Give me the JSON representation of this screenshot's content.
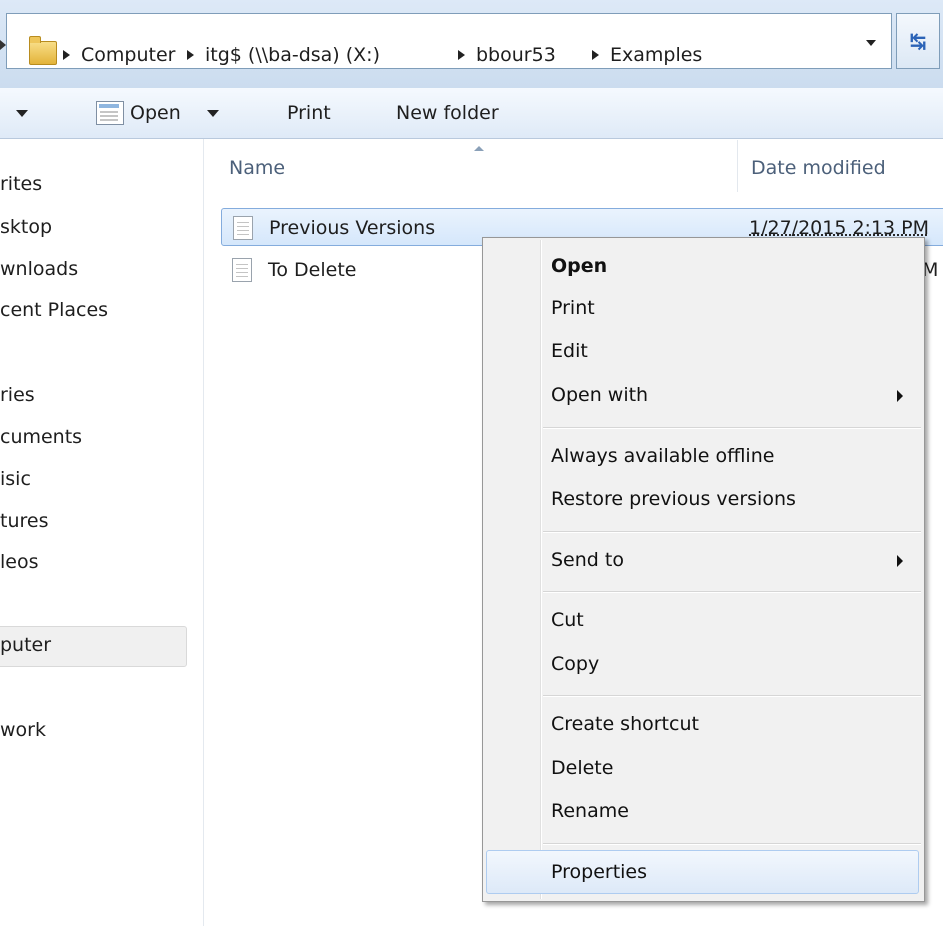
{
  "address_bar": {
    "crumbs": [
      "Computer",
      "itg$ (\\\\ba-dsa) (X:)",
      "bbour53",
      "Examples"
    ],
    "refresh_icon": "refresh-arrows-icon"
  },
  "command_bar": {
    "open_label": "Open",
    "print_label": "Print",
    "new_folder_label": "New folder"
  },
  "nav_pane": {
    "items": [
      "rites",
      "sktop",
      "wnloads",
      "cent Places",
      "ries",
      "cuments",
      "isic",
      "tures",
      "leos",
      "puter",
      "work"
    ]
  },
  "file_list": {
    "columns": {
      "name": "Name",
      "date_modified": "Date modified"
    },
    "rows": [
      {
        "name": "Previous Versions",
        "date": "1/27/2015 2:13 PM",
        "selected": true
      },
      {
        "name": "To Delete",
        "date": "M",
        "selected": false
      }
    ]
  },
  "context_menu": {
    "items": {
      "open": "Open",
      "print": "Print",
      "edit": "Edit",
      "open_with": "Open with",
      "offline": "Always available offline",
      "restore": "Restore previous versions",
      "send_to": "Send to",
      "cut": "Cut",
      "copy": "Copy",
      "create_shortcut": "Create shortcut",
      "delete": "Delete",
      "rename": "Rename",
      "properties": "Properties"
    },
    "highlighted": "Properties",
    "highlight_color": "#dde9f8"
  },
  "colors": {
    "chrome_blue": "#cbdcef",
    "selection_border": "#84acdd",
    "header_text": "#4c607a"
  }
}
